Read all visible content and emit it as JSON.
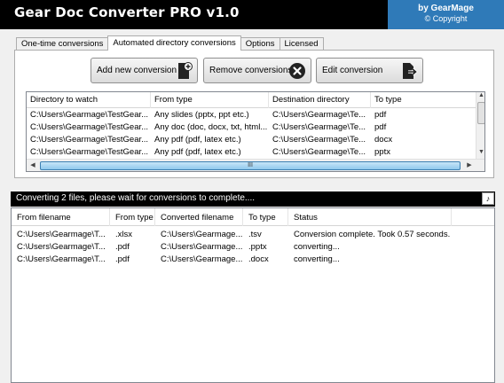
{
  "app": {
    "title": "Gear Doc Converter PRO v1.0",
    "brand": {
      "line1": "by GearMage",
      "line2": "© Copyright"
    },
    "colors": {
      "titlebar": "#000000",
      "brand": "#2f7ab8",
      "progress": "#8fc8ec"
    }
  },
  "tabs": [
    {
      "label": "One-time conversions",
      "active": false
    },
    {
      "label": "Automated directory conversions",
      "active": true
    },
    {
      "label": "Options",
      "active": false
    },
    {
      "label": "Licensed",
      "active": false
    }
  ],
  "toolbar": {
    "add_label": "Add new conversion",
    "add_icon": "file-plus-icon",
    "remove_label": "Remove conversions",
    "remove_icon": "remove-x-icon",
    "edit_label": "Edit conversion",
    "edit_icon": "file-export-icon"
  },
  "directories": {
    "columns": [
      "Directory to watch",
      "From type",
      "Destination directory",
      "To type"
    ],
    "rows": [
      [
        "C:\\Users\\Gearmage\\TestGear...",
        "Any slides (pptx, ppt etc.)",
        "C:\\Users\\Gearmage\\Te...",
        "pdf"
      ],
      [
        "C:\\Users\\Gearmage\\TestGear...",
        "Any doc (doc, docx, txt, html...",
        "C:\\Users\\Gearmage\\Te...",
        "pdf"
      ],
      [
        "C:\\Users\\Gearmage\\TestGear...",
        "Any pdf (pdf, latex etc.)",
        "C:\\Users\\Gearmage\\Te...",
        "docx"
      ],
      [
        "C:\\Users\\Gearmage\\TestGear...",
        "Any pdf (pdf, latex etc.)",
        "C:\\Users\\Gearmage\\Te...",
        "pptx"
      ]
    ],
    "scroll_grip": "III"
  },
  "status": {
    "message": "Converting 2 files, please wait for conversions to complete....",
    "icon": "note-icon"
  },
  "conversions": {
    "columns": [
      "From filename",
      "From type",
      "Converted filename",
      "To type",
      "Status"
    ],
    "rows": [
      [
        "C:\\Users\\Gearmage\\T...",
        ".xlsx",
        "C:\\Users\\Gearmage...",
        ".tsv",
        "Conversion complete. Took 0.57 seconds."
      ],
      [
        "C:\\Users\\Gearmage\\T...",
        ".pdf",
        "C:\\Users\\Gearmage...",
        ".pptx",
        "converting..."
      ],
      [
        "C:\\Users\\Gearmage\\T...",
        ".pdf",
        "C:\\Users\\Gearmage...",
        ".docx",
        "converting..."
      ]
    ]
  }
}
